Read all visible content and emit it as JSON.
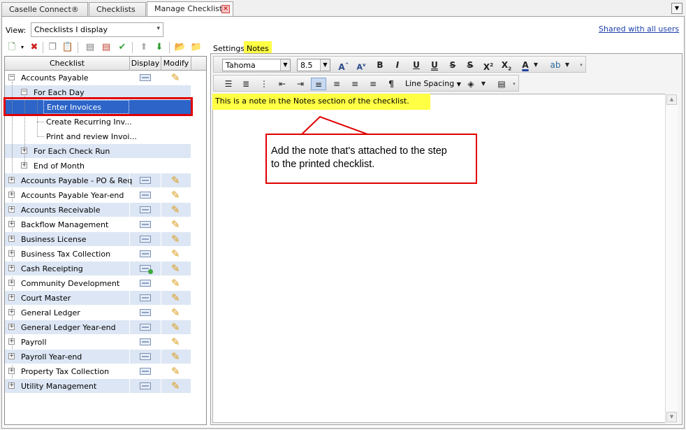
{
  "tabs": [
    {
      "label": "Caselle Connect®"
    },
    {
      "label": "Checklists"
    },
    {
      "label": "Manage Checklists"
    }
  ],
  "view": {
    "label": "View:",
    "value": "Checklists I display"
  },
  "shared_link": "Shared with all users",
  "grid": {
    "headers": {
      "checklist": "Checklist",
      "display": "Display",
      "modify": "Modify"
    },
    "rows": [
      {
        "label": "Accounts Payable"
      },
      {
        "label": "For Each Day"
      },
      {
        "label": "Enter Invoices"
      },
      {
        "label": "Create Recurring Inv..."
      },
      {
        "label": "Print and review Invoi..."
      },
      {
        "label": "For Each Check Run"
      },
      {
        "label": "End of Month"
      },
      {
        "label": "Accounts Payable - PO & Req"
      },
      {
        "label": "Accounts Payable Year-end"
      },
      {
        "label": "Accounts Receivable"
      },
      {
        "label": "Backflow Management"
      },
      {
        "label": "Business License"
      },
      {
        "label": "Business Tax Collection"
      },
      {
        "label": "Cash Receipting"
      },
      {
        "label": "Community Development"
      },
      {
        "label": "Court Master"
      },
      {
        "label": "General Ledger"
      },
      {
        "label": "General Ledger Year-end"
      },
      {
        "label": "Payroll"
      },
      {
        "label": "Payroll Year-end"
      },
      {
        "label": "Property Tax Collection"
      },
      {
        "label": "Utility Management"
      }
    ]
  },
  "right_tabs": {
    "settings": "Settings",
    "notes": "Notes"
  },
  "format": {
    "font": "Tahoma",
    "size": "8.5",
    "line_spacing": "Line Spacing"
  },
  "note_text": "This is a note in the Notes section of the checklist.",
  "callout": {
    "line1": "Add the note that's attached to the step",
    "line2": "to the printed checklist."
  },
  "colors": {
    "highlight": "#ffff44",
    "callout_border": "#e00000",
    "selection": "#2c64c8"
  }
}
